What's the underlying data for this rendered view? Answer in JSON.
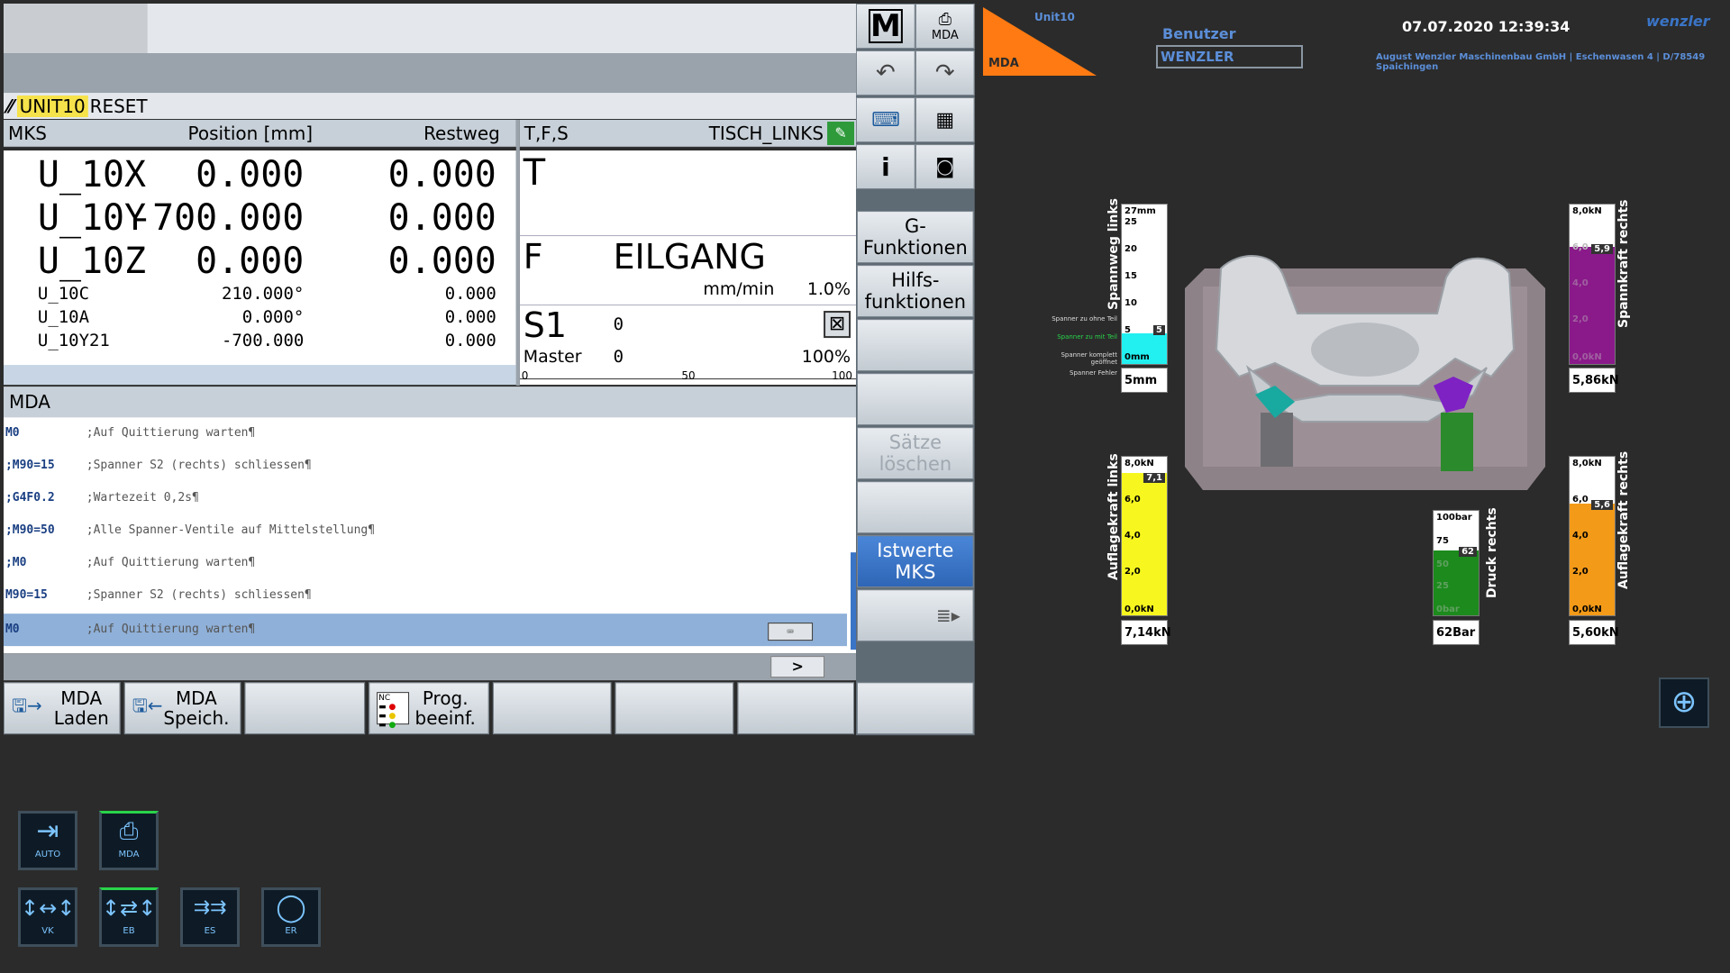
{
  "channel": {
    "unit": "UNIT10",
    "status": "RESET"
  },
  "position": {
    "header": {
      "mks": "MKS",
      "position": "Position [mm]",
      "restweg": "Restweg"
    },
    "axes_big": [
      {
        "name": "U_10X",
        "pos": "0.000",
        "rest": "0.000"
      },
      {
        "name": "U_10Y",
        "pos": "-700.000",
        "rest": "0.000"
      },
      {
        "name": "U_10Z",
        "pos": "0.000",
        "rest": "0.000"
      }
    ],
    "axes_small": [
      {
        "name": "U_10C",
        "pos": "210.000°",
        "rest": "0.000"
      },
      {
        "name": "U_10A",
        "pos": "0.000°",
        "rest": "0.000"
      },
      {
        "name": "U_10Y21",
        "pos": "-700.000",
        "rest": "0.000"
      }
    ]
  },
  "tfs": {
    "title": "T,F,S",
    "tool": "TISCH_LINKS",
    "t_label": "T",
    "f_label": "F",
    "f_value": "EILGANG",
    "f_unit": "mm/min",
    "f_percent": "1.0%",
    "s_label": "S1",
    "s_value": "0",
    "master_label": "Master",
    "master_value": "0",
    "master_percent": "100%",
    "scale": [
      "0",
      "50",
      "100"
    ]
  },
  "mda": {
    "title": "MDA",
    "lines": [
      {
        "code": "M0",
        "comment": ";Auf Quittierung warten¶"
      },
      {
        "code": ";M90=15",
        "comment": ";Spanner S2 (rechts) schliessen¶"
      },
      {
        "code": ";G4F0.2",
        "comment": ";Wartezeit 0,2s¶"
      },
      {
        "code": ";M90=50",
        "comment": ";Alle Spanner-Ventile auf Mittelstellung¶"
      },
      {
        "code": ";M0",
        "comment": " ;Auf Quittierung warten¶"
      },
      {
        "code": "M90=15",
        "comment": ";Spanner S2 (rechts) schliessen¶"
      },
      {
        "code": "M0",
        "comment": ";Auf Quittierung warten¶"
      }
    ],
    "arrow": ">"
  },
  "vertical_softkeys": {
    "mda": "MDA",
    "g_func": "G-\nFunktionen",
    "hilfs": "Hilfs-\nfunktionen",
    "saetze": "Sätze\nlöschen",
    "istwerte": "Istwerte\nMKS"
  },
  "horizontal_softkeys": {
    "mda_laden": "MDA\nLaden",
    "mda_speich": "MDA\nSpeich.",
    "prog_beeinf": "Prog.\nbeeinf.",
    "nc": "NC"
  },
  "hmi": {
    "unit": "Unit10",
    "mode": "MDA",
    "benutzer_label": "Benutzer",
    "benutzer": "WENZLER",
    "datetime": "07.07.2020 12:39:34",
    "logo": "wenzler",
    "company": "August Wenzler Maschinenbau GmbH | Eschenwasen 4 | D/78549 Spaichingen"
  },
  "gauges": {
    "spannweg_links": {
      "label": "Spannweg links",
      "ticks": [
        "27mm",
        "25",
        "20",
        "15",
        "10",
        "5",
        "0mm"
      ],
      "marker": "5",
      "value": "5mm",
      "level": 0.19,
      "legend": [
        "Spanner zu ohne Teil",
        "Spanner zu mit Teil",
        "Spanner komplett geöffnet",
        "Spanner Fehler"
      ]
    },
    "spannkraft_rechts": {
      "label": "Spannkraft rechts",
      "ticks": [
        "8,0kN",
        "6,0",
        "4,0",
        "2,0",
        "0,0kN"
      ],
      "marker": "5,9",
      "value": "5,86kN",
      "level": 0.73
    },
    "auflagekraft_links": {
      "label": "Auflagekraft links",
      "ticks": [
        "8,0kN",
        "6,0",
        "4,0",
        "2,0",
        "0,0kN"
      ],
      "marker": "7,1",
      "value": "7,14kN",
      "level": 0.89
    },
    "druck_rechts": {
      "label": "Druck rechts",
      "ticks": [
        "100bar",
        "75",
        "50",
        "25",
        "0bar"
      ],
      "marker": "62",
      "value": "62Bar",
      "level": 0.62
    },
    "auflagekraft_rechts": {
      "label": "Auflagekraft rechts",
      "ticks": [
        "8,0kN",
        "6,0",
        "4,0",
        "2,0",
        "0,0kN"
      ],
      "marker": "5,6",
      "value": "5,60kN",
      "level": 0.7
    }
  },
  "modes": {
    "auto": "AUTO",
    "mda": "MDA",
    "vk": "VK",
    "eb": "EB",
    "es": "ES",
    "er": "ER"
  },
  "colors": {
    "spannweg": "#22f0f0",
    "spannkraft": "#8a1a8a",
    "auflage_links": "#f7f71f",
    "druck": "#1c8a1c",
    "auflage_rechts": "#f39a18",
    "mode_triangle": "#ff7a12",
    "active": "#29d34a",
    "softkey_blue": "#3a74c6"
  }
}
